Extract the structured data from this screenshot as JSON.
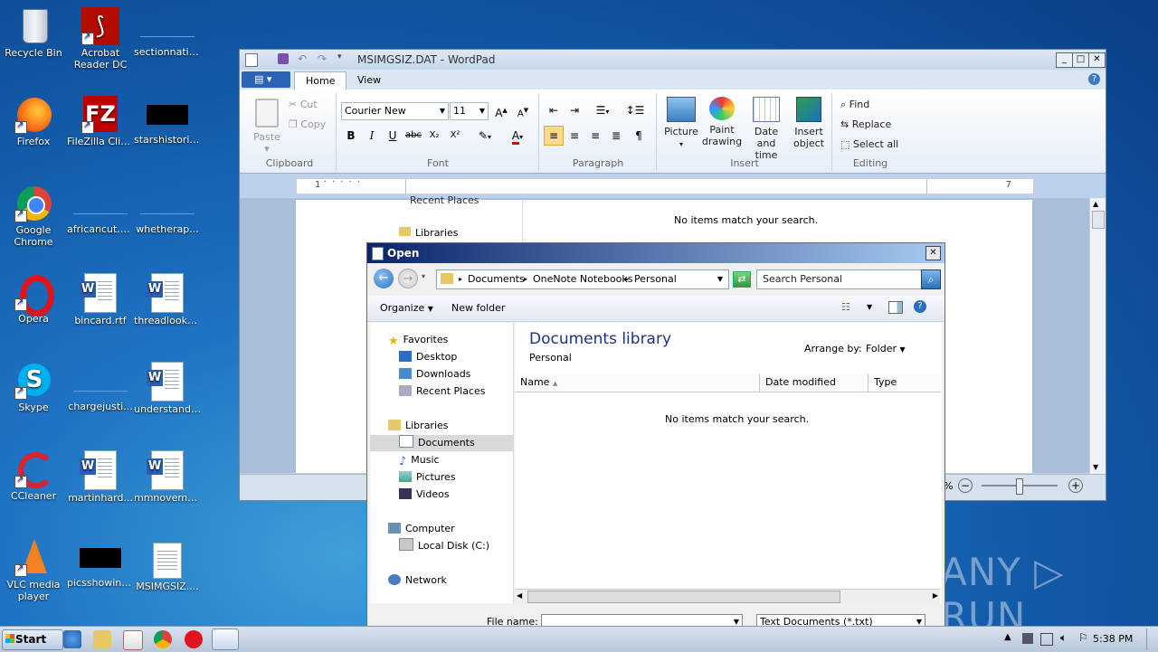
{
  "desktop": {
    "icons": [
      {
        "label": "Recycle Bin",
        "icon": "recycle-bin-icon"
      },
      {
        "label": "Acrobat Reader DC",
        "icon": "acrobat-icon"
      },
      {
        "label": "sectionnatio...",
        "icon": "file-icon"
      },
      {
        "label": "Firefox",
        "icon": "firefox-icon"
      },
      {
        "label": "FileZilla Client",
        "icon": "filezilla-icon"
      },
      {
        "label": "starshistoric...",
        "icon": "file-icon"
      },
      {
        "label": "Google Chrome",
        "icon": "chrome-icon"
      },
      {
        "label": "africancut.png",
        "icon": "image-file-icon"
      },
      {
        "label": "whetherap...",
        "icon": "file-icon"
      },
      {
        "label": "Opera",
        "icon": "opera-icon"
      },
      {
        "label": "bincard.rtf",
        "icon": "word-document-icon"
      },
      {
        "label": "threadlooks...",
        "icon": "word-document-icon"
      },
      {
        "label": "Skype",
        "icon": "skype-icon"
      },
      {
        "label": "chargejusti...",
        "icon": "file-icon"
      },
      {
        "label": "understandi...",
        "icon": "word-document-icon"
      },
      {
        "label": "CCleaner",
        "icon": "ccleaner-icon"
      },
      {
        "label": "martinhard...",
        "icon": "word-document-icon"
      },
      {
        "label": "mmnovemb...",
        "icon": "word-document-icon"
      },
      {
        "label": "VLC media player",
        "icon": "vlc-icon"
      },
      {
        "label": "picsshowing...",
        "icon": "file-icon"
      },
      {
        "label": "MSIMGSIZ....",
        "icon": "dat-file-icon"
      }
    ]
  },
  "wordpad": {
    "title": "MSIMGSIZ.DAT - WordPad",
    "tabs": [
      "Home",
      "View"
    ],
    "clipboard": {
      "paste": "Paste",
      "cut": "Cut",
      "copy": "Copy",
      "group": "Clipboard"
    },
    "font": {
      "family": "Courier New",
      "size": "11",
      "group": "Font"
    },
    "paragraph": {
      "group": "Paragraph"
    },
    "insert": {
      "picture": "Picture",
      "paint1": "Paint",
      "paint2": "drawing",
      "date1": "Date and",
      "date2": "time",
      "obj1": "Insert",
      "obj2": "object",
      "group": "Insert"
    },
    "editing": {
      "find": "Find",
      "replace": "Replace",
      "select_all": "Select all",
      "group": "Editing"
    },
    "ruler": {
      "left_mark": "1",
      "right_mark": "7"
    },
    "behind_text": {
      "recent_places": "Recent Places",
      "libraries": "Libraries",
      "no_items": "No items match your search."
    },
    "status": {
      "zoom_pct": "%"
    }
  },
  "open_dialog": {
    "title": "Open",
    "breadcrumb": [
      "Documents",
      "OneNote Notebooks",
      "Personal"
    ],
    "search_placeholder": "Search Personal",
    "toolbar": {
      "organize": "Organize",
      "new_folder": "New folder"
    },
    "nav": {
      "favorites": "Favorites",
      "desktop": "Desktop",
      "downloads": "Downloads",
      "recent_places": "Recent Places",
      "libraries": "Libraries",
      "documents": "Documents",
      "music": "Music",
      "pictures": "Pictures",
      "videos": "Videos",
      "computer": "Computer",
      "local_disk": "Local Disk (C:)",
      "network": "Network"
    },
    "library_title": "Documents library",
    "library_sub": "Personal",
    "arrange_by_label": "Arrange by:",
    "arrange_by_value": "Folder",
    "columns": [
      "Name",
      "Date modified",
      "Type"
    ],
    "empty_message": "No items match your search.",
    "file_name_label": "File name:",
    "file_name_value": "",
    "file_type": "Text Documents (*.txt)"
  },
  "taskbar": {
    "start": "Start",
    "clock": "5:38 PM"
  },
  "watermark": "ANY ▷ RUN"
}
